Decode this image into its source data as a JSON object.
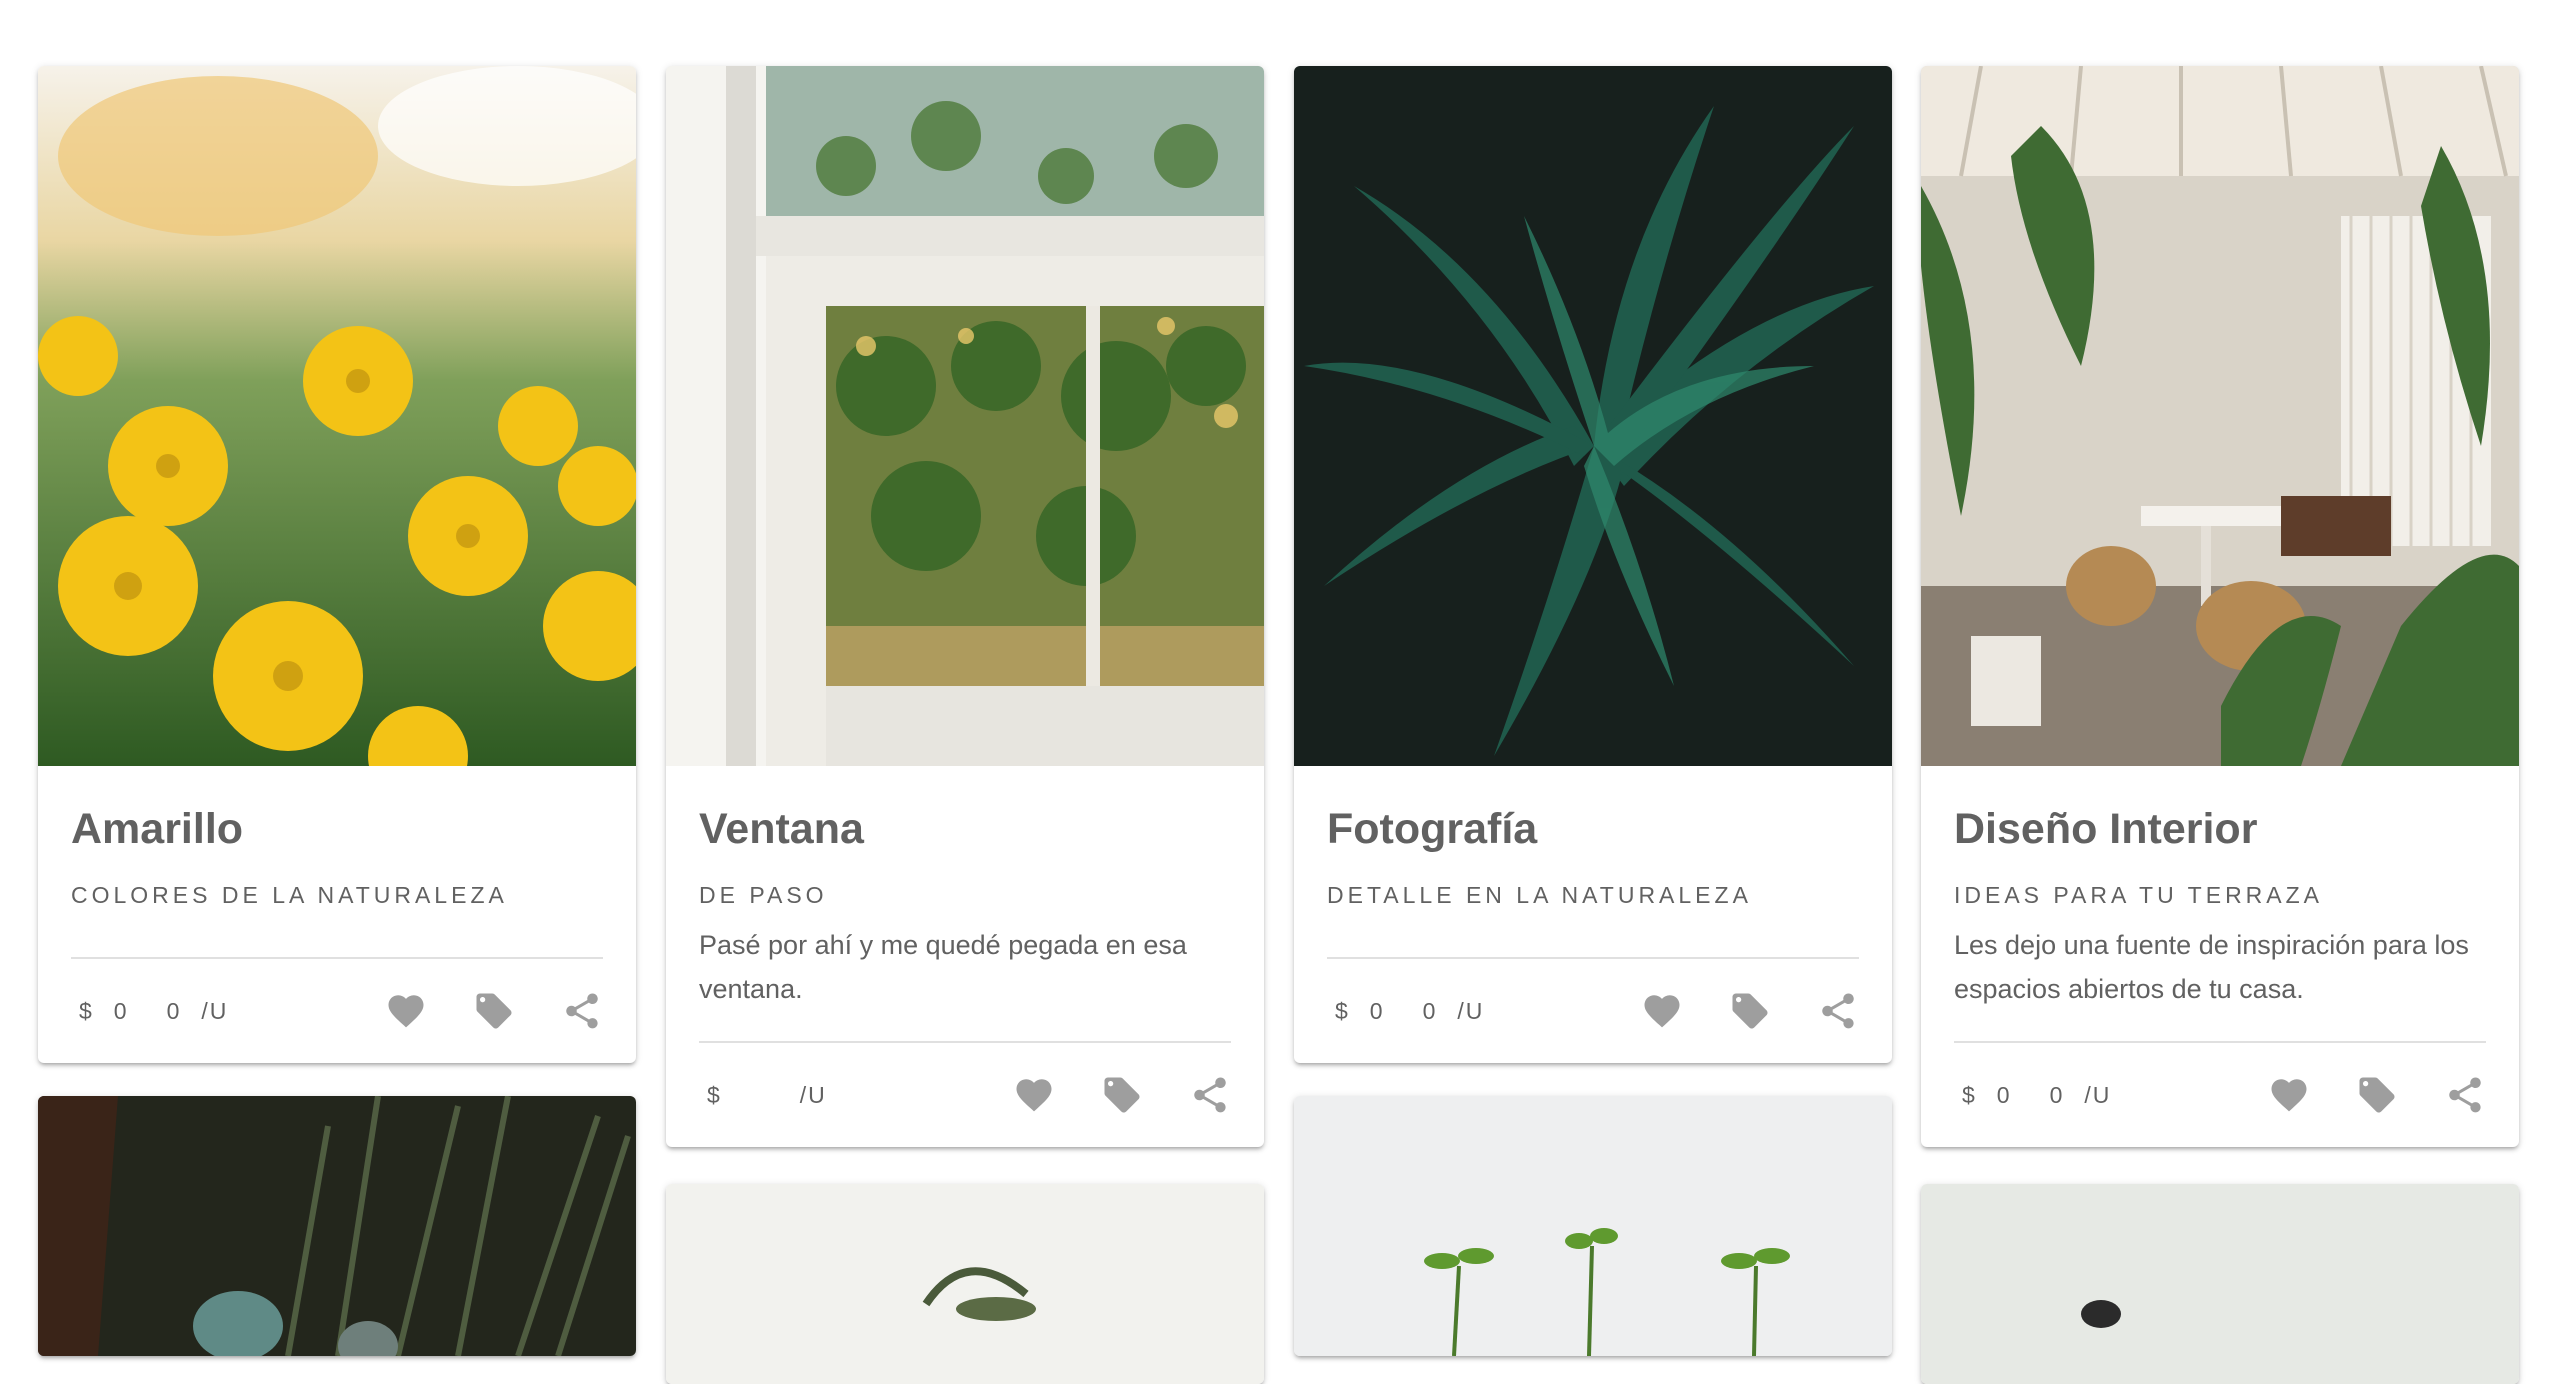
{
  "cards": [
    {
      "title": "Amarillo",
      "subtitle": "COLORES DE LA NATURALEZA",
      "description": "",
      "price": {
        "currency": "$",
        "amount": "0",
        "qty": "0",
        "unit": "/U"
      },
      "image_icon": "yellow-flowers-image"
    },
    {
      "title": "Ventana",
      "subtitle": "DE PASO",
      "description": "Pasé por ahí y me quedé pegada en esa ventana.",
      "price": {
        "currency": "$",
        "amount": "",
        "qty": "",
        "unit": "/U"
      },
      "image_icon": "window-plants-image"
    },
    {
      "title": "Fotografía",
      "subtitle": "DETALLE EN LA NATURALEZA",
      "description": "",
      "price": {
        "currency": "$",
        "amount": "0",
        "qty": "0",
        "unit": "/U"
      },
      "image_icon": "dark-leaves-image"
    },
    {
      "title": "Diseño Interior",
      "subtitle": "IDEAS PARA TU TERRAZA",
      "description": "Les dejo una fuente de inspiración para los espacios abiertos de tu casa.",
      "price": {
        "currency": "$",
        "amount": "0",
        "qty": "0",
        "unit": "/U"
      },
      "image_icon": "terrace-image"
    }
  ],
  "colors": {
    "icon": "#9e9e9e",
    "text": "#616161",
    "divider": "#e0e0e0"
  },
  "icons": [
    "heart-icon",
    "tag-icon",
    "share-icon"
  ]
}
